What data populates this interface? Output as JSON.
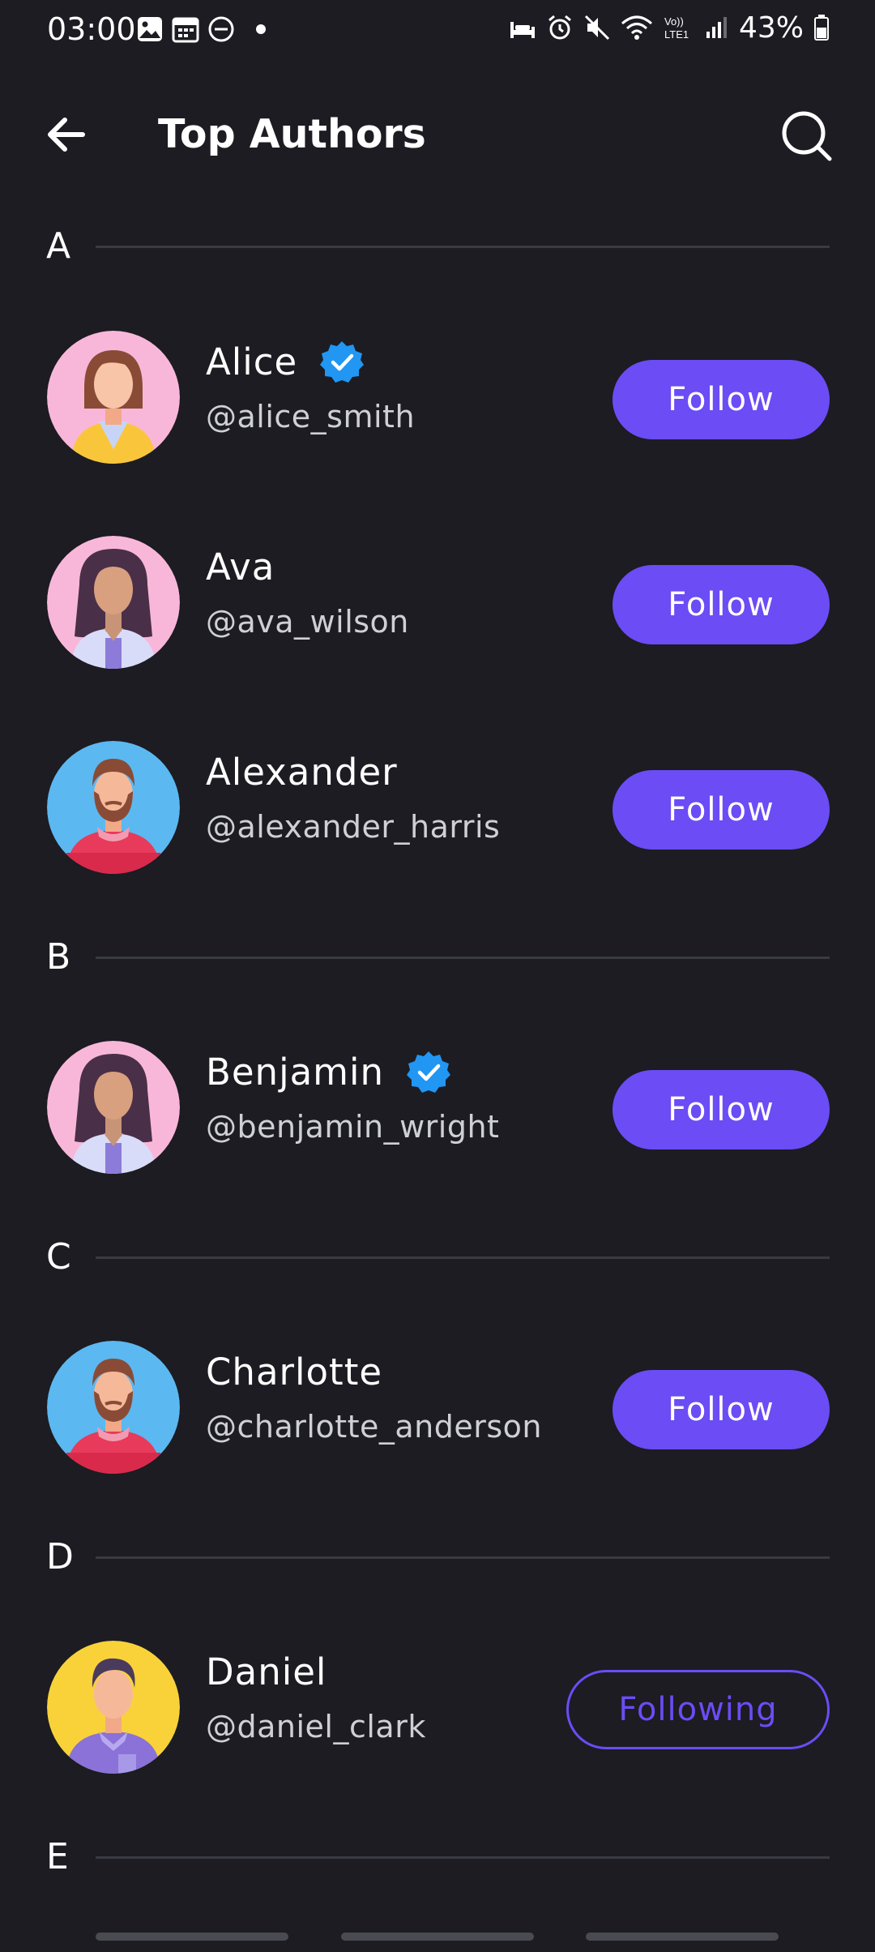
{
  "status_bar": {
    "time": "03:00",
    "battery": "43%",
    "icons_left": [
      "image-icon",
      "calendar-icon",
      "dnd-icon",
      "dot-icon"
    ],
    "icons_right": [
      "sleep-icon",
      "alarm-icon",
      "mute-icon",
      "wifi-icon",
      "volte-icon",
      "signal-icon",
      "battery-icon"
    ]
  },
  "header": {
    "title": "Top Authors"
  },
  "sections": [
    {
      "letter": "A"
    },
    {
      "letter": "B"
    },
    {
      "letter": "C"
    },
    {
      "letter": "D"
    },
    {
      "letter": "E"
    }
  ],
  "authors": [
    {
      "name": "Alice",
      "handle": "@alice_smith",
      "verified": true,
      "button": "Follow",
      "avatar": "woman-short-hair"
    },
    {
      "name": "Ava",
      "handle": "@ava_wilson",
      "verified": false,
      "button": "Follow",
      "avatar": "woman-long-hair"
    },
    {
      "name": "Alexander",
      "handle": "@alexander_harris",
      "verified": false,
      "button": "Follow",
      "avatar": "man-beard"
    },
    {
      "name": "Benjamin",
      "handle": "@benjamin_wright",
      "verified": true,
      "button": "Follow",
      "avatar": "woman-long-hair"
    },
    {
      "name": "Charlotte",
      "handle": "@charlotte_anderson",
      "verified": false,
      "button": "Follow",
      "avatar": "man-beard"
    },
    {
      "name": "Daniel",
      "handle": "@daniel_clark",
      "verified": false,
      "button": "Following",
      "avatar": "man-purple-shirt"
    }
  ],
  "colors": {
    "background": "#1c1c22",
    "accent": "#6c4cf5",
    "verified": "#2196f3",
    "divider": "#3a3a42"
  }
}
